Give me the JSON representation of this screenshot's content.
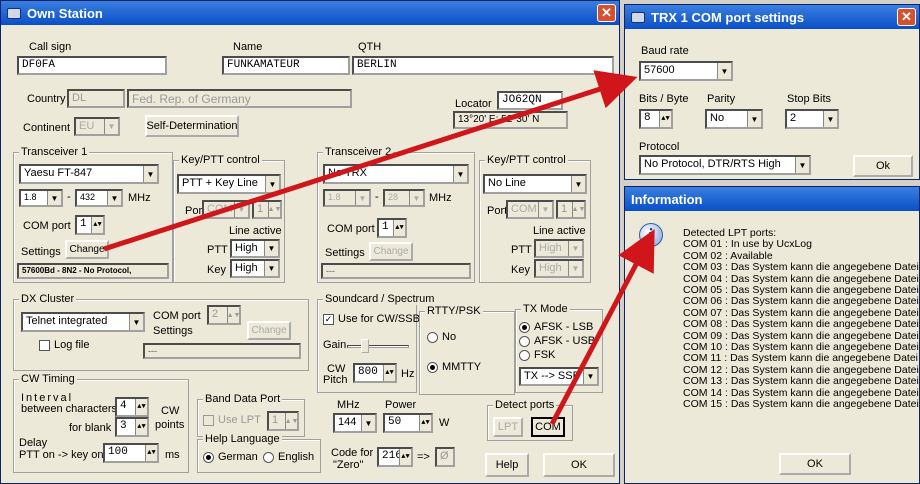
{
  "own": {
    "title": "Own Station",
    "callsign_label": "Call sign",
    "callsign": "DF0FA",
    "name_label": "Name",
    "name": "FUNKAMATEUR",
    "qth_label": "QTH",
    "qth": "BERLIN",
    "country_label": "Country",
    "country_code": "DL",
    "country_name": "Fed. Rep. of Germany",
    "locator_label": "Locator",
    "locator": "JO62QN",
    "coords": "13°20' E; 52°30' N",
    "continent_label": "Continent",
    "continent": "EU",
    "self_det": "Self-Determination",
    "trx1": {
      "label": "Transceiver 1",
      "model": "Yaesu FT-847",
      "fmin": "1.8",
      "fmax": "432",
      "mhz": "MHz",
      "com_label": "COM port",
      "com": "1",
      "settings_label": "Settings",
      "change": "Change",
      "status": "57600Bd - 8N2 - No Protocol,"
    },
    "kp1": {
      "label": "Key/PTT control",
      "mode": "PTT + Key Line",
      "port_label": "Port",
      "port": "COM",
      "port_num": "1",
      "line_active": "Line active",
      "ptt_label": "PTT",
      "ptt": "High",
      "key_label": "Key",
      "key": "High"
    },
    "trx2": {
      "label": "Transceiver 2",
      "model": "No TRX",
      "fmin": "1.8",
      "fmax": "28",
      "mhz": "MHz",
      "com_label": "COM port",
      "com": "1",
      "settings_label": "Settings",
      "change": "Change",
      "status": "---"
    },
    "kp2": {
      "label": "Key/PTT control",
      "mode": "No Line",
      "port_label": "Port",
      "port": "COM",
      "port_num": "1",
      "line_active": "Line active",
      "ptt_label": "PTT",
      "ptt": "High",
      "key_label": "Key",
      "key": "High"
    },
    "dx": {
      "label": "DX Cluster",
      "mode": "Telnet integrated",
      "com_label": "COM port",
      "com": "2",
      "settings_label": "Settings",
      "change": "Change",
      "logfile": "Log file",
      "status": "---"
    },
    "sc": {
      "label": "Soundcard / Spectrum",
      "use_cw": "Use for CW/SSB",
      "gain": "Gain",
      "cw_pitch_1": "CW",
      "cw_pitch_2": "Pitch",
      "pitch": "800",
      "hz": "Hz"
    },
    "rtty": {
      "label": "RTTY/PSK",
      "no": "No",
      "mmtty": "MMTTY"
    },
    "tx": {
      "label": "TX Mode",
      "afsk_lsb": "AFSK - LSB",
      "afsk_usb": "AFSK - USB",
      "fsk": "FSK",
      "route": "TX --> SSB"
    },
    "cw": {
      "label": "CW Timing",
      "interval": "Interval",
      "between": "between characters",
      "between_val": "4",
      "blank": "for blank",
      "blank_val": "3",
      "cw1": "CW",
      "cw2": "points",
      "delay": "Delay",
      "ptt_on": "PTT on -> key on",
      "delay_val": "100",
      "ms": "ms"
    },
    "band": {
      "label": "Band Data Port",
      "use_lpt": "Use LPT",
      "val": "1"
    },
    "help_lang": {
      "label": "Help Language",
      "german": "German",
      "english": "English"
    },
    "power": {
      "mhz": "MHz",
      "power": "Power",
      "band": "144",
      "watts": "50",
      "w": "W"
    },
    "code": {
      "l1": "Code for",
      "l2": "\"Zero\"",
      "val": "216",
      "arrow": "=>",
      "zero": "Ø"
    },
    "detect": {
      "label": "Detect ports",
      "lpt": "LPT",
      "com": "COM"
    },
    "help": "Help",
    "ok": "OK"
  },
  "trxcom": {
    "title": "TRX 1 COM port settings",
    "baud_label": "Baud rate",
    "baud": "57600",
    "bits_label": "Bits / Byte",
    "bits": "8",
    "parity_label": "Parity",
    "parity": "No",
    "stop_label": "Stop Bits",
    "stop": "2",
    "protocol_label": "Protocol",
    "protocol": "No Protocol, DTR/RTS High",
    "ok": "Ok"
  },
  "info": {
    "title": "Information",
    "lines": [
      "Detected LPT ports:",
      "COM 01 : In use by UcxLog",
      "COM 02 : Available",
      "COM 03 : Das System kann die angegebene Datei",
      "COM 04 : Das System kann die angegebene Datei",
      "COM 05 : Das System kann die angegebene Datei",
      "COM 06 : Das System kann die angegebene Datei",
      "COM 07 : Das System kann die angegebene Datei",
      "COM 08 : Das System kann die angegebene Datei",
      "COM 09 : Das System kann die angegebene Datei",
      "COM 10 : Das System kann die angegebene Datei",
      "COM 11 : Das System kann die angegebene Datei",
      "COM 12 : Das System kann die angegebene Datei",
      "COM 13 : Das System kann die angegebene Datei",
      "COM 14 : Das System kann die angegebene Datei",
      "COM 15 : Das System kann die angegebene Datei"
    ],
    "ok": "OK"
  },
  "colors": {
    "arrow": "#d0161a",
    "title_bar": "#0a4fc8"
  }
}
